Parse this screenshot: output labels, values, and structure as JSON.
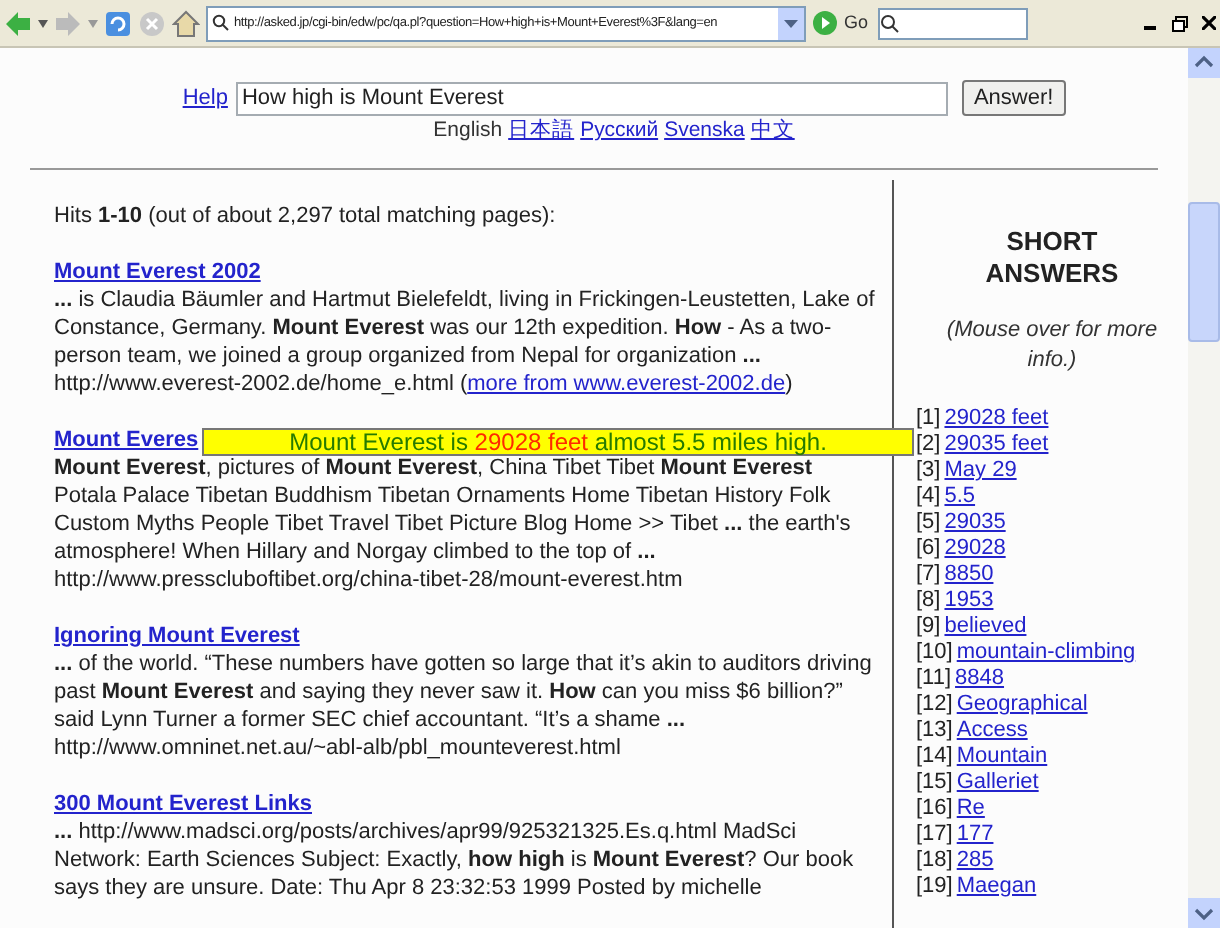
{
  "browser": {
    "url": "http://asked.jp/cgi-bin/edw/pc/qa.pl?question=How+high+is+Mount+Everest%3F&lang=en",
    "go_label": "Go"
  },
  "search": {
    "help": "Help",
    "query": "How high is Mount Everest",
    "button": "Answer!",
    "languages": [
      {
        "label": "English",
        "kind": "current"
      },
      {
        "label": "日本語",
        "kind": "link"
      },
      {
        "label": "Русский",
        "kind": "link"
      },
      {
        "label": "Svenska",
        "kind": "link"
      },
      {
        "label": "中文",
        "kind": "link"
      }
    ]
  },
  "hits": "Hits **1-10** (out of about 2,297 total matching pages):",
  "results": [
    {
      "title": "Mount Everest 2002",
      "snippet": "**...** is Claudia Bäumler and Hartmut Bielefeldt, living in Frickingen-Leustetten, Lake of Constance, Germany. **Mount Everest** was our 12th expedition. **How** - As a two-person team, we joined a group organized from Nepal for organization **...**",
      "url": "http://www.everest-2002.de/home_e.html",
      "more_open": "(",
      "more": "more from www.everest-2002.de",
      "more_close": ")"
    },
    {
      "title": "Mount Everes",
      "snippet": "**Mount Everest**, pictures of **Mount Everest**, China Tibet Tibet **Mount Everest** Potala Palace Tibetan Buddhism Tibetan Ornaments Home Tibetan History Folk Custom Myths People Tibet Travel Tibet Picture Blog   Home >> Tibet **...** the earth's atmosphere! When Hillary and Norgay climbed to the top of **...**",
      "url": "http://www.presscluboftibet.org/china-tibet-28/mount-everest.htm"
    },
    {
      "title": "Ignoring Mount Everest",
      "snippet": "**...** of the world. “These numbers have gotten so large that it’s akin to auditors driving past **Mount Everest** and saying they never saw it. **How** can you miss $6 billion?” said Lynn Turner a former SEC chief accountant. “It’s a shame **...**",
      "url": "http://www.omninet.net.au/~abl-alb/pbl_mounteverest.html"
    },
    {
      "title": "300 Mount Everest Links",
      "snippet": "**...** http://www.madsci.org/posts/archives/apr99/925321325.Es.q.html MadSci Network: Earth Sciences Subject: Exactly, **how high** is **Mount Everest**? Our book says they are unsure. Date: Thu Apr 8 23:32:53 1999 Posted by michelle"
    }
  ],
  "tooltip": {
    "before": "Mount Everest is ",
    "highlight": "29028 feet",
    "after": " almost 5.5 miles high."
  },
  "sidebar": {
    "title": "SHORT ANSWERS",
    "note": "(Mouse over for more info.)",
    "answers": [
      {
        "index": "[1]",
        "label": "29028 feet"
      },
      {
        "index": "[2]",
        "label": "29035 feet"
      },
      {
        "index": "[3]",
        "label": "May 29"
      },
      {
        "index": "[4]",
        "label": "5.5"
      },
      {
        "index": "[5]",
        "label": "29035"
      },
      {
        "index": "[6]",
        "label": "29028"
      },
      {
        "index": "[7]",
        "label": "8850"
      },
      {
        "index": "[8]",
        "label": "1953"
      },
      {
        "index": "[9]",
        "label": "believed"
      },
      {
        "index": "[10]",
        "label": "mountain-climbing"
      },
      {
        "index": "[11]",
        "label": "8848"
      },
      {
        "index": "[12]",
        "label": "Geographical"
      },
      {
        "index": "[13]",
        "label": "Access"
      },
      {
        "index": "[14]",
        "label": "Mountain"
      },
      {
        "index": "[15]",
        "label": "Galleriet"
      },
      {
        "index": "[16]",
        "label": "Re"
      },
      {
        "index": "[17]",
        "label": "177"
      },
      {
        "index": "[18]",
        "label": "285"
      },
      {
        "index": "[19]",
        "label": "Maegan"
      }
    ]
  }
}
